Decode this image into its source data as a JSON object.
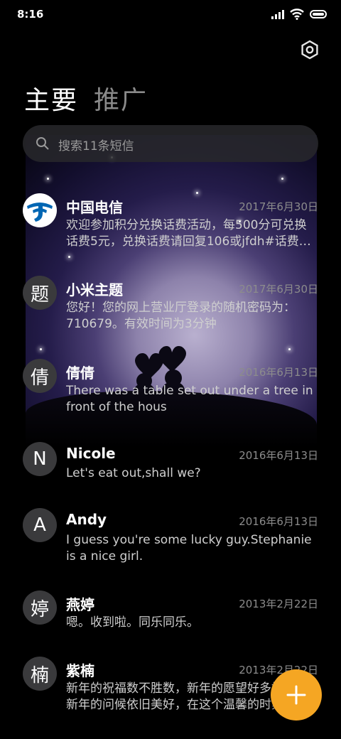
{
  "status_bar": {
    "time": "8:16"
  },
  "tabs": {
    "primary": "主要",
    "promo": "推广"
  },
  "search": {
    "placeholder": "搜索11条短信"
  },
  "conversations": [
    {
      "avatar": "",
      "avatar_icon": "china-telecom-logo-icon",
      "name": "中国电信",
      "date": "2017年6月30日",
      "message": "欢迎参加积分兑换话费活动，每500分可兑换话费5元，兑换话费请回复106或jfdh#话费…"
    },
    {
      "avatar": "题",
      "name": "小米主题",
      "date": "2017年6月30日",
      "message": "您好！您的网上营业厅登录的随机密码为：710679。有效时间为3分钟"
    },
    {
      "avatar": "倩",
      "name": "倩倩",
      "date": "2016年6月13日",
      "message": "There was a table set out under a tree in front of the hous"
    },
    {
      "avatar": "N",
      "name": "Nicole",
      "date": "2016年6月13日",
      "message": "Let's eat out,shall we?"
    },
    {
      "avatar": "A",
      "name": "Andy",
      "date": "2016年6月13日",
      "message": "I guess you're some lucky guy.Stephanie is a nice girl."
    },
    {
      "avatar": "婷",
      "name": "燕婷",
      "date": "2013年2月22日",
      "message": "嗯。收到啦。同乐同乐。"
    },
    {
      "avatar": "楠",
      "name": "紫楠",
      "date": "2013年2月22日",
      "message": "新年的祝福数不胜数，新年的愿望好多好多，新年的问候依旧美好，在这个温馨的时刻"
    }
  ],
  "colors": {
    "fab": "#f5a623",
    "background": "#000000",
    "telecom_blue": "#0066b3"
  },
  "icons": {
    "settings": "settings-hexagon-icon",
    "search": "search-icon",
    "fab": "plus-icon"
  }
}
